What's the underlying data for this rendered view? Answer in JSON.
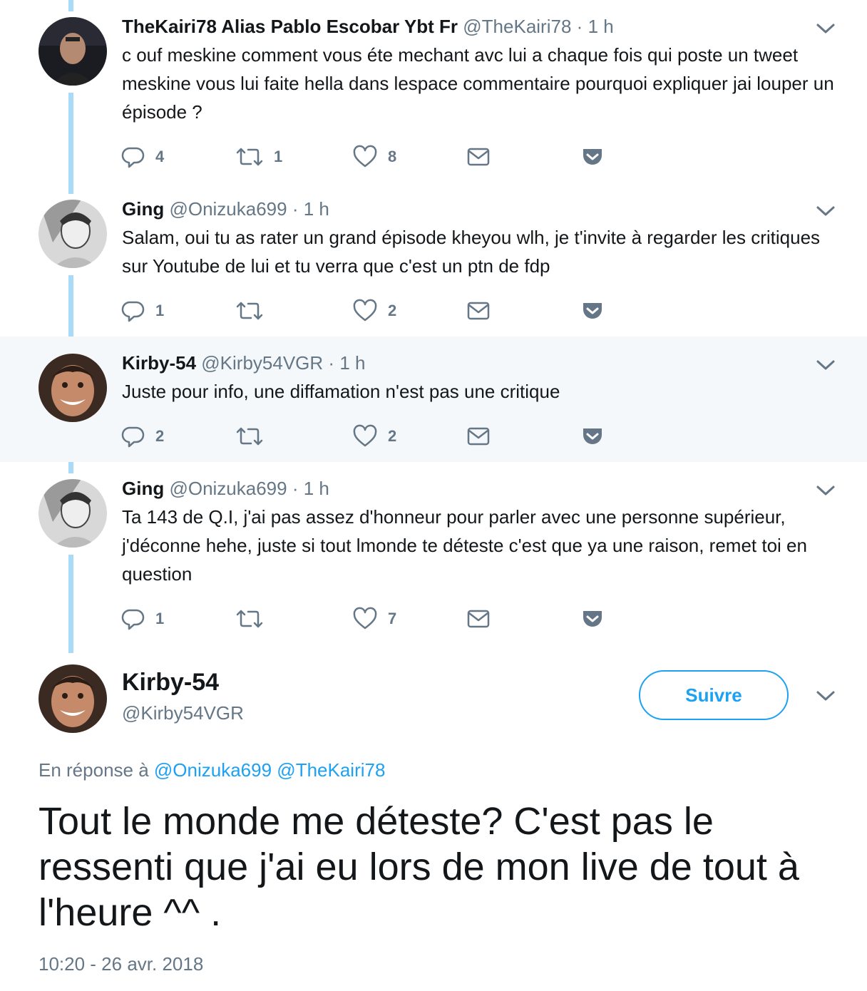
{
  "tweets": [
    {
      "name": "TheKairi78 Alias Pablo Escobar Ybt Fr",
      "handle": "@TheKairi78",
      "separator": "·",
      "time": "1 h",
      "text": "c ouf meskine comment vous éte mechant avc lui a chaque fois qui poste un tweet meskine vous lui faite hella dans lespace commentaire pourquoi expliquer jai louper un épisode ?",
      "replies": "4",
      "retweets": "1",
      "likes": "8"
    },
    {
      "name": "Ging",
      "handle": "@Onizuka699",
      "separator": "·",
      "time": "1 h",
      "text": "Salam, oui tu as rater un grand épisode kheyou wlh, je t'invite à regarder les critiques sur Youtube de lui et tu verra que c'est un ptn de fdp",
      "replies": "1",
      "retweets": "",
      "likes": "2"
    },
    {
      "name": "Kirby-54",
      "handle": "@Kirby54VGR",
      "separator": "·",
      "time": "1 h",
      "text": "Juste pour info, une diffamation n'est pas une critique",
      "replies": "2",
      "retweets": "",
      "likes": "2"
    },
    {
      "name": "Ging",
      "handle": "@Onizuka699",
      "separator": "·",
      "time": "1 h",
      "text": "Ta 143 de Q.I, j'ai pas assez d'honneur pour parler avec une personne supérieur, j'déconne hehe, juste si tout lmonde te déteste c'est que ya une raison, remet toi en question",
      "replies": "1",
      "retweets": "",
      "likes": "7"
    }
  ],
  "main": {
    "name": "Kirby-54",
    "handle": "@Kirby54VGR",
    "follow_label": "Suivre",
    "reply_prefix": "En réponse à",
    "reply_mentions": [
      "@Onizuka699",
      "@TheKairi78"
    ],
    "text": "Tout le monde me déteste? C'est pas le ressenti que j'ai eu lors de mon live de tout à l'heure ^^ .",
    "timestamp": "10:20 - 26 avr. 2018"
  },
  "colors": {
    "accent": "#1da1f2",
    "thread_line": "#a9dbf9",
    "muted_text": "#657786",
    "highlight_bg": "#f5f8fa"
  },
  "icons": [
    "reply-icon",
    "retweet-icon",
    "like-icon",
    "direct-message-icon",
    "pocket-icon",
    "chevron-down-icon"
  ]
}
